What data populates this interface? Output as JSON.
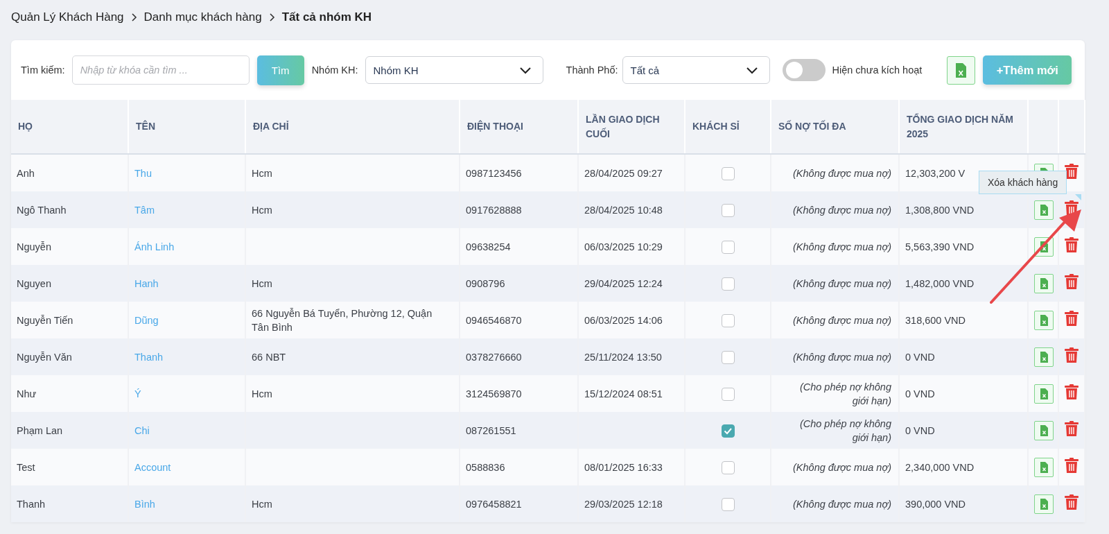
{
  "breadcrumb": [
    {
      "label": "Quản Lý Khách Hàng",
      "current": false
    },
    {
      "label": "Danh mục khách hàng",
      "current": false
    },
    {
      "label": "Tất cả nhóm KH",
      "current": true
    }
  ],
  "filters": {
    "search": {
      "label": "Tìm kiếm:",
      "placeholder": "Nhập từ khóa cần tìm ..."
    },
    "search_button": "Tìm",
    "group": {
      "label": "Nhóm KH:",
      "value": "Nhóm KH"
    },
    "city": {
      "label": "Thành Phố:",
      "value": "Tất cả"
    },
    "toggle": {
      "label": "Hiện chưa kích hoạt",
      "on": false
    },
    "add_button": "+Thêm mới"
  },
  "table": {
    "columns": [
      "HỌ",
      "TÊN",
      "ĐỊA CHỈ",
      "ĐIỆN THOẠI",
      "LẦN GIAO DỊCH CUỐI",
      "KHÁCH SỈ",
      "SỐ NỢ TỐI ĐA",
      "TỔNG GIAO DỊCH NĂM 2025"
    ],
    "rows": [
      {
        "last_name": "Anh",
        "first_name": "Thu",
        "address": "Hcm",
        "phone": "0987123456",
        "last_transaction": "28/04/2025 09:27",
        "wholesale": false,
        "max_debt": "(Không được mua nợ)",
        "total": "12,303,200 V"
      },
      {
        "last_name": "Ngô Thanh",
        "first_name": "Tâm",
        "address": "Hcm",
        "phone": "0917628888",
        "last_transaction": "28/04/2025 10:48",
        "wholesale": false,
        "max_debt": "(Không được mua nợ)",
        "total": "1,308,800 VND"
      },
      {
        "last_name": "Nguyễn",
        "first_name": "Ánh Linh",
        "address": "",
        "phone": "09638254",
        "last_transaction": "06/03/2025 10:29",
        "wholesale": false,
        "max_debt": "(Không được mua nợ)",
        "total": "5,563,390 VND"
      },
      {
        "last_name": "Nguyen",
        "first_name": "Hanh",
        "address": "Hcm",
        "phone": "0908796",
        "last_transaction": "29/04/2025 12:24",
        "wholesale": false,
        "max_debt": "(Không được mua nợ)",
        "total": "1,482,000 VND"
      },
      {
        "last_name": "Nguyễn Tiến",
        "first_name": "Dũng",
        "address": "66 Nguyễn Bá Tuyển, Phường 12, Quận Tân Bình",
        "phone": "0946546870",
        "last_transaction": "06/03/2025 14:06",
        "wholesale": false,
        "max_debt": "(Không được mua nợ)",
        "total": "318,600 VND"
      },
      {
        "last_name": "Nguyễn Văn",
        "first_name": "Thanh",
        "address": "66 NBT",
        "phone": "0378276660",
        "last_transaction": "25/11/2024 13:50",
        "wholesale": false,
        "max_debt": "(Không được mua nợ)",
        "total": "0 VND"
      },
      {
        "last_name": "Như",
        "first_name": "Ý",
        "address": "Hcm",
        "phone": "3124569870",
        "last_transaction": "15/12/2024 08:51",
        "wholesale": false,
        "max_debt": "(Cho phép nợ không giới hạn)",
        "total": "0 VND"
      },
      {
        "last_name": "Phạm Lan",
        "first_name": "Chi",
        "address": "",
        "phone": "087261551",
        "last_transaction": "",
        "wholesale": true,
        "max_debt": "(Cho phép nợ không giới hạn)",
        "total": "0 VND"
      },
      {
        "last_name": "Test",
        "first_name": "Account",
        "address": "",
        "phone": "0588836",
        "last_transaction": "08/01/2025 16:33",
        "wholesale": false,
        "max_debt": "(Không được mua nợ)",
        "total": "2,340,000 VND"
      },
      {
        "last_name": "Thanh",
        "first_name": "Bình",
        "address": "Hcm",
        "phone": "0976458821",
        "last_transaction": "29/03/2025 12:18",
        "wholesale": false,
        "max_debt": "(Không được mua nợ)",
        "total": "390,000 VND"
      }
    ]
  },
  "tooltip": {
    "text": "Xóa khách hàng"
  }
}
